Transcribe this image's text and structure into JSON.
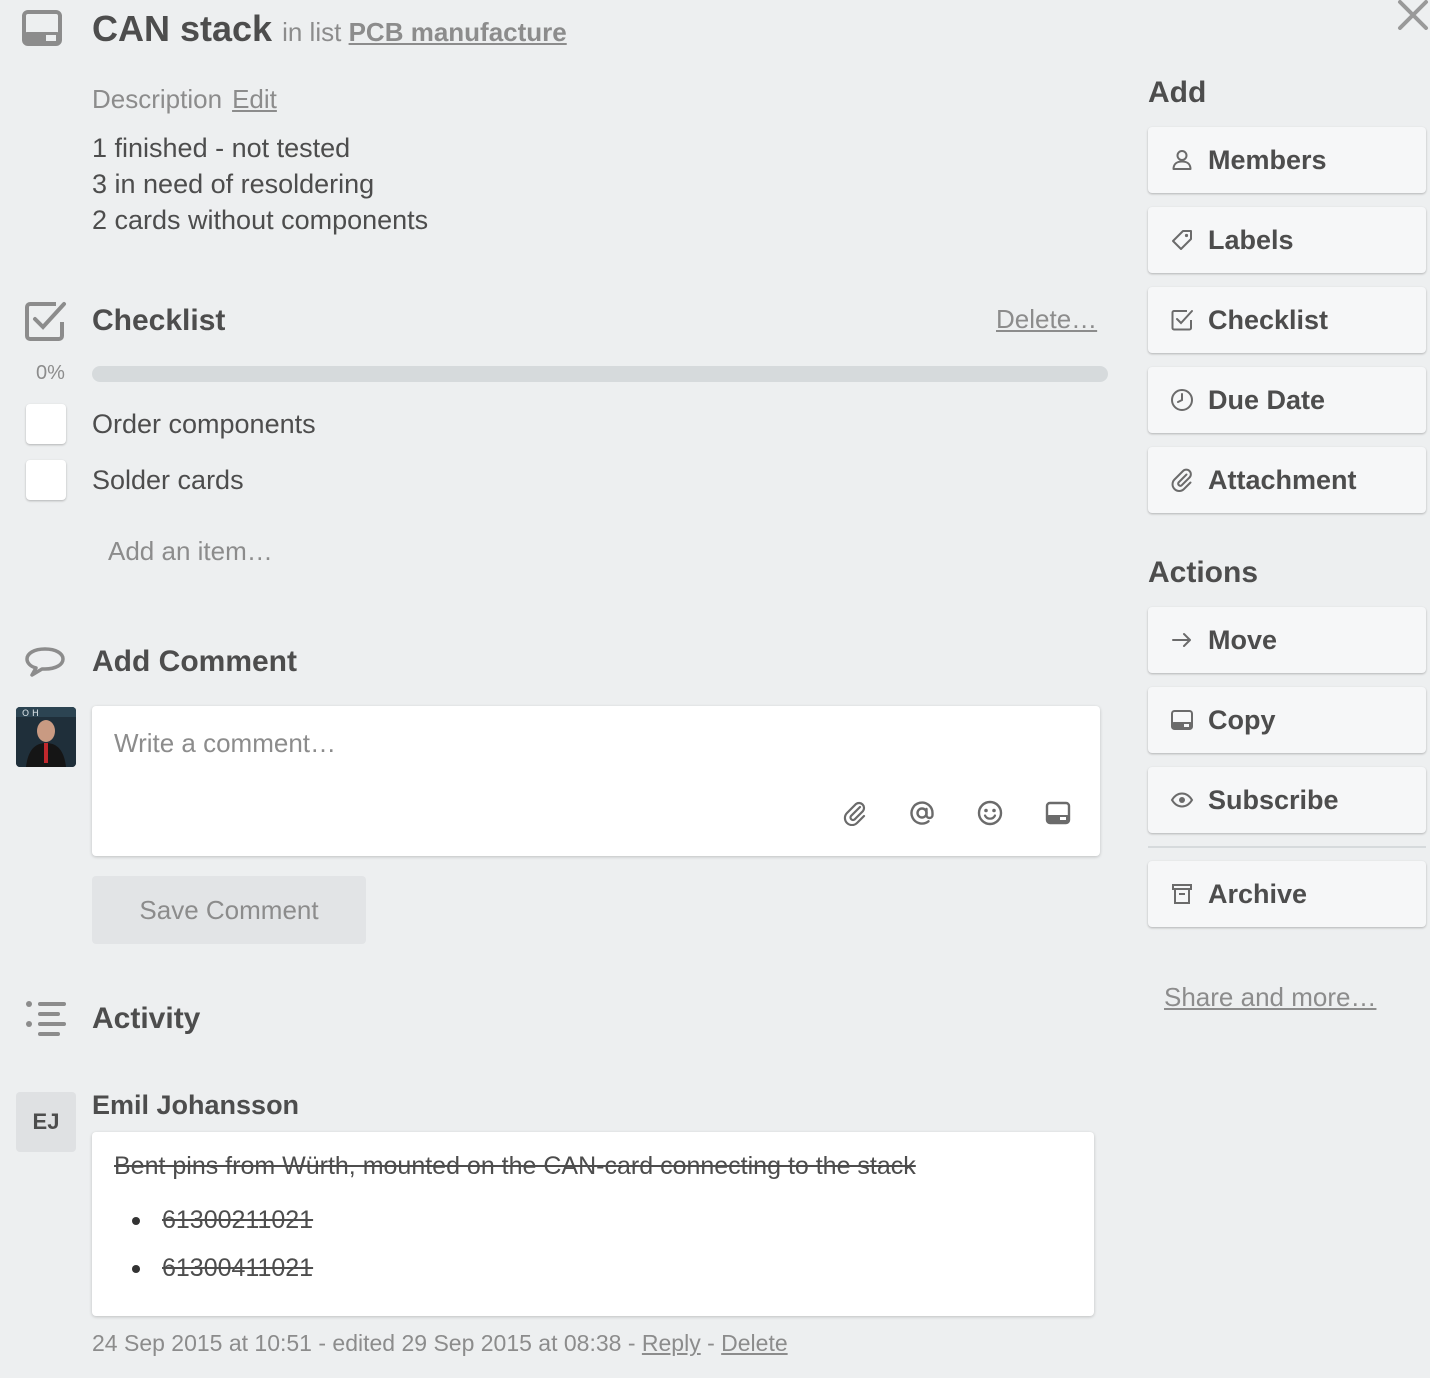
{
  "card": {
    "title": "CAN stack",
    "in_list_prefix": "in list",
    "list_name": "PCB manufacture"
  },
  "description": {
    "label": "Description",
    "edit_label": "Edit",
    "lines": [
      "1 finished - not tested",
      "3 in need of resoldering",
      "2 cards without components"
    ]
  },
  "checklist": {
    "title": "Checklist",
    "delete_label": "Delete…",
    "progress_label": "0%",
    "progress_fraction": 0,
    "items": [
      {
        "label": "Order components",
        "checked": false
      },
      {
        "label": "Solder cards",
        "checked": false
      }
    ],
    "add_item_placeholder": "Add an item…"
  },
  "comment": {
    "title": "Add Comment",
    "placeholder": "Write a comment…",
    "save_label": "Save Comment",
    "toolbar_icons": [
      "paperclip-icon",
      "mention-icon",
      "emoji-icon",
      "card-icon"
    ]
  },
  "activity": {
    "title": "Activity",
    "entries": [
      {
        "initials": "EJ",
        "author": "Emil Johansson",
        "text": "Bent pins from Würth, mounted on the CAN-card connecting to the stack",
        "bullets": [
          "61300211021",
          "61300411021"
        ],
        "timestamp": "24 Sep 2015 at 10:51 - edited 29 Sep 2015 at 08:38 -",
        "reply_label": "Reply",
        "separator": "-",
        "delete_label": "Delete"
      }
    ]
  },
  "sidebar": {
    "add_heading": "Add",
    "add_buttons": [
      {
        "label": "Members",
        "icon": "person-icon"
      },
      {
        "label": "Labels",
        "icon": "tag-icon"
      },
      {
        "label": "Checklist",
        "icon": "checkbox-icon"
      },
      {
        "label": "Due Date",
        "icon": "clock-icon"
      },
      {
        "label": "Attachment",
        "icon": "paperclip-icon"
      }
    ],
    "actions_heading": "Actions",
    "action_buttons": [
      {
        "label": "Move",
        "icon": "arrow-right-icon"
      },
      {
        "label": "Copy",
        "icon": "card-icon"
      },
      {
        "label": "Subscribe",
        "icon": "eye-icon"
      },
      {
        "label": "Archive",
        "icon": "archive-icon"
      }
    ],
    "share_label": "Share and more…"
  },
  "colors": {
    "background": "#edeff0",
    "text": "#4d4d4d",
    "muted": "#8c8c8c",
    "button_bg": "#f6f7f8"
  }
}
